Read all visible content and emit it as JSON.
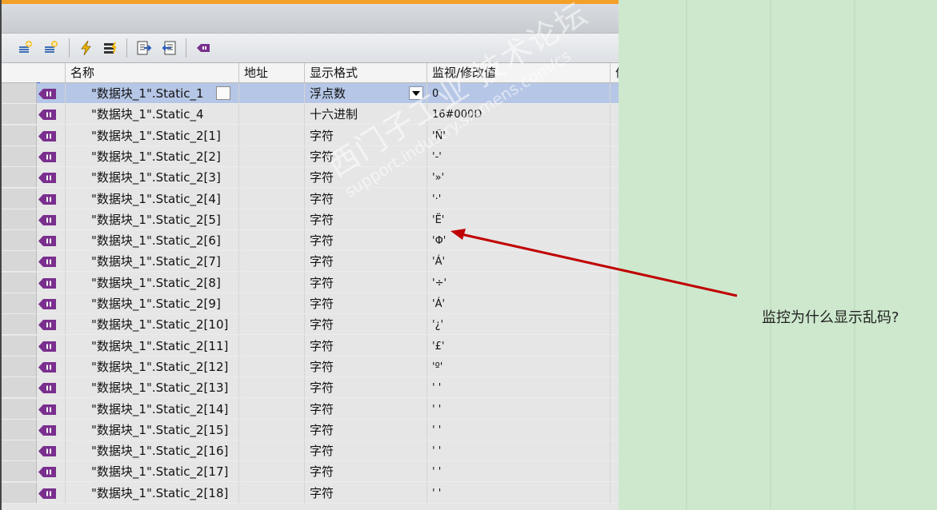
{
  "toolbar": {
    "icons": [
      "insert-row-icon",
      "add-row-icon",
      "modify-now-icon",
      "modify-triggered-icon",
      "show-all-icon",
      "expand-icon",
      "variable-tag-icon"
    ]
  },
  "table": {
    "columns": [
      "名称",
      "地址",
      "显示格式",
      "监视/修改值",
      "值"
    ],
    "rows": [
      {
        "name": "\"数据块_1\".Static_1",
        "address": "",
        "format": "浮点数",
        "value": "0"
      },
      {
        "name": "\"数据块_1\".Static_4",
        "address": "",
        "format": "十六进制",
        "value": "16#000D"
      },
      {
        "name": "\"数据块_1\".Static_2[1]",
        "address": "",
        "format": "字符",
        "value": "'Ñ'"
      },
      {
        "name": "\"数据块_1\".Static_2[2]",
        "address": "",
        "format": "字符",
        "value": "'-'"
      },
      {
        "name": "\"数据块_1\".Static_2[3]",
        "address": "",
        "format": "字符",
        "value": "'»'"
      },
      {
        "name": "\"数据块_1\".Static_2[4]",
        "address": "",
        "format": "字符",
        "value": "'·'"
      },
      {
        "name": "\"数据块_1\".Static_2[5]",
        "address": "",
        "format": "字符",
        "value": "'Ë'"
      },
      {
        "name": "\"数据块_1\".Static_2[6]",
        "address": "",
        "format": "字符",
        "value": "'Φ'"
      },
      {
        "name": "\"数据块_1\".Static_2[7]",
        "address": "",
        "format": "字符",
        "value": "'Á'"
      },
      {
        "name": "\"数据块_1\".Static_2[8]",
        "address": "",
        "format": "字符",
        "value": "'÷'"
      },
      {
        "name": "\"数据块_1\".Static_2[9]",
        "address": "",
        "format": "字符",
        "value": "'Á'"
      },
      {
        "name": "\"数据块_1\".Static_2[10]",
        "address": "",
        "format": "字符",
        "value": "'¿'"
      },
      {
        "name": "\"数据块_1\".Static_2[11]",
        "address": "",
        "format": "字符",
        "value": "'£'"
      },
      {
        "name": "\"数据块_1\".Static_2[12]",
        "address": "",
        "format": "字符",
        "value": "'º'"
      },
      {
        "name": "\"数据块_1\".Static_2[13]",
        "address": "",
        "format": "字符",
        "value": "' '"
      },
      {
        "name": "\"数据块_1\".Static_2[14]",
        "address": "",
        "format": "字符",
        "value": "' '"
      },
      {
        "name": "\"数据块_1\".Static_2[15]",
        "address": "",
        "format": "字符",
        "value": "' '"
      },
      {
        "name": "\"数据块_1\".Static_2[16]",
        "address": "",
        "format": "字符",
        "value": "' '"
      },
      {
        "name": "\"数据块_1\".Static_2[17]",
        "address": "",
        "format": "字符",
        "value": "' '"
      },
      {
        "name": "\"数据块_1\".Static_2[18]",
        "address": "",
        "format": "字符",
        "value": "' '"
      }
    ]
  },
  "watermark": {
    "line1": "西门子工业 技术论坛",
    "line2": "support.industry.siemens.com/cs"
  },
  "annotation": {
    "text": "监控为什么显示乱码?"
  },
  "colors": {
    "accent_orange": "#f3a029",
    "selection": "#b6c6e6",
    "arrow": "#c00000",
    "background_green": "#cde8cd"
  }
}
